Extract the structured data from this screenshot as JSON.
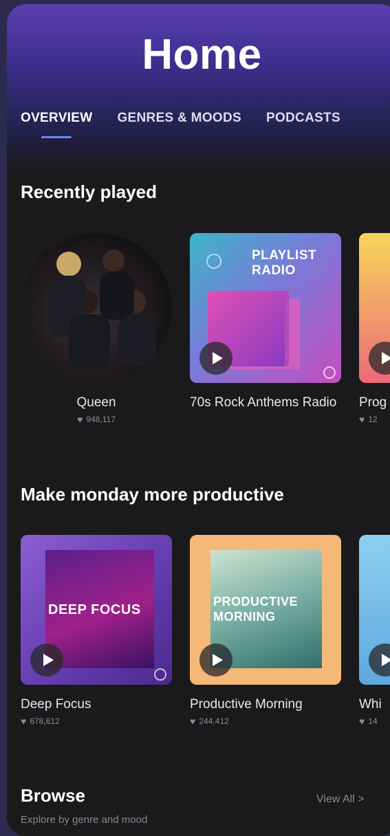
{
  "header": {
    "title": "Home",
    "tabs": [
      {
        "label": "OVERVIEW",
        "active": true
      },
      {
        "label": "GENRES & MOODS",
        "active": false
      },
      {
        "label": "PODCASTS",
        "active": false
      }
    ]
  },
  "recently_played": {
    "title": "Recently played",
    "items": [
      {
        "name": "Queen",
        "fans": "948,117",
        "art_text": ""
      },
      {
        "name": "70s Rock Anthems Radio",
        "fans": "",
        "art_text": "PLAYLIST RADIO"
      },
      {
        "name": "Prog",
        "fans": "12",
        "art_text": ""
      }
    ]
  },
  "monday": {
    "title": "Make monday more productive",
    "items": [
      {
        "name": "Deep Focus",
        "fans": "678,612",
        "art_text": "DEEP FOCUS"
      },
      {
        "name": "Productive Morning",
        "fans": "244,412",
        "art_text": "PRODUCTIVE MORNING"
      },
      {
        "name": "Whi",
        "fans": "14",
        "art_text": ""
      }
    ]
  },
  "browse": {
    "title": "Browse",
    "subtitle": "Explore by genre and mood",
    "view_all": "View All  >"
  },
  "colors": {
    "accent": "#6a8cff",
    "background": "#1a1a1c"
  }
}
